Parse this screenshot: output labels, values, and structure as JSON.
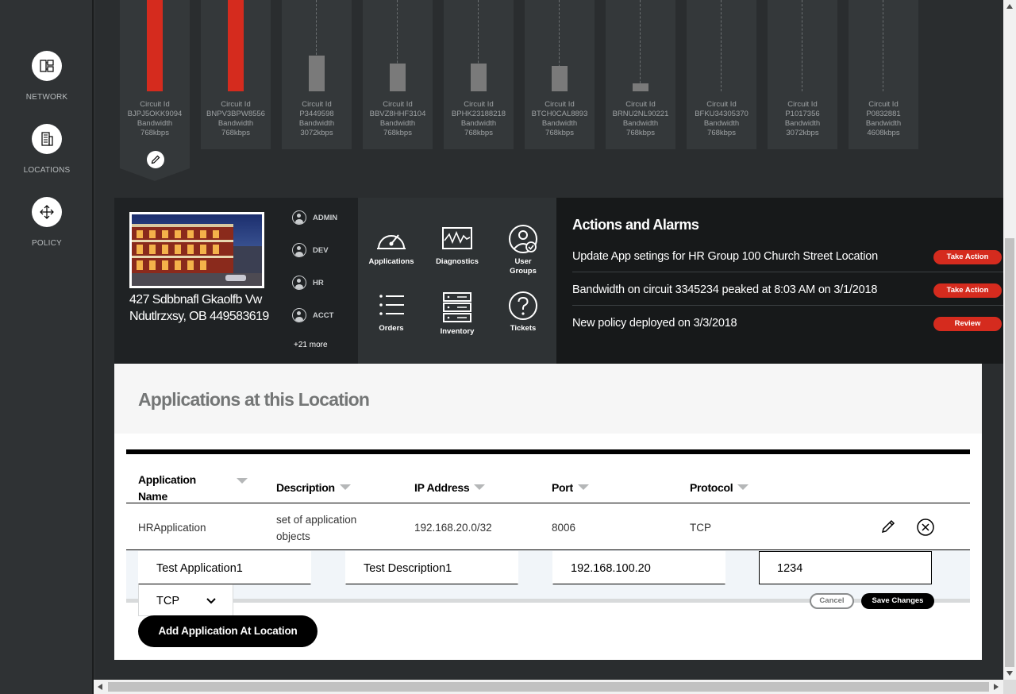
{
  "sidebar": {
    "items": [
      {
        "label": "NETWORK",
        "icon": "network-icon"
      },
      {
        "label": "LOCATIONS",
        "icon": "building-icon"
      },
      {
        "label": "POLICY",
        "icon": "move-arrows-icon"
      }
    ]
  },
  "circuits": [
    {
      "label": "Circuit Id",
      "id": "BJPJ5OKK9094",
      "bw_label": "Bandwidth",
      "bandwidth": "768kbps",
      "level": 1.0,
      "alert": true,
      "selected": true
    },
    {
      "label": "Circuit Id",
      "id": "BNPV3BPW8556",
      "bw_label": "Bandwidth",
      "bandwidth": "768kbps",
      "level": 1.0,
      "alert": true,
      "selected": false
    },
    {
      "label": "Circuit Id",
      "id": "P3449598",
      "bw_label": "Bandwidth",
      "bandwidth": "3072kbps",
      "level": 0.39,
      "alert": false,
      "selected": false
    },
    {
      "label": "Circuit Id",
      "id": "BBVZ8HHF3104",
      "bw_label": "Bandwidth",
      "bandwidth": "768kbps",
      "level": 0.3,
      "alert": false,
      "selected": false
    },
    {
      "label": "Circuit Id",
      "id": "BPHK23188218",
      "bw_label": "Bandwidth",
      "bandwidth": "768kbps",
      "level": 0.3,
      "alert": false,
      "selected": false
    },
    {
      "label": "Circuit Id",
      "id": "BTCH0CAL8893",
      "bw_label": "Bandwidth",
      "bandwidth": "768kbps",
      "level": 0.28,
      "alert": false,
      "selected": false
    },
    {
      "label": "Circuit Id",
      "id": "BRNU2NL90221",
      "bw_label": "Bandwidth",
      "bandwidth": "768kbps",
      "level": 0.09,
      "alert": false,
      "selected": false
    },
    {
      "label": "Circuit Id",
      "id": "BFKU34305370",
      "bw_label": "Bandwidth",
      "bandwidth": "768kbps",
      "level": 0.0,
      "alert": false,
      "selected": false
    },
    {
      "label": "Circuit Id",
      "id": "P1017356",
      "bw_label": "Bandwidth",
      "bandwidth": "3072kbps",
      "level": 0.0,
      "alert": false,
      "selected": false
    },
    {
      "label": "Circuit Id",
      "id": "P0832881",
      "bw_label": "Bandwidth",
      "bandwidth": "4608kbps",
      "level": 0.0,
      "alert": false,
      "selected": false
    }
  ],
  "location": {
    "address_line1": "427 Sdbbnafl Gkaolfb Vw",
    "address_line2": "Ndutlrzxsy, OB 449583619",
    "groups": [
      "ADMIN",
      "DEV",
      "HR",
      "ACCT"
    ],
    "more_groups": "+21 more"
  },
  "tiles": [
    {
      "label": "Applications",
      "icon": "speedometer-icon"
    },
    {
      "label": "Diagnostics",
      "icon": "waveform-icon"
    },
    {
      "label": "User Groups",
      "icon": "user-check-icon"
    },
    {
      "label": "Orders",
      "icon": "list-icon"
    },
    {
      "label": "Inventory",
      "icon": "server-icon"
    },
    {
      "label": "Tickets",
      "icon": "help-icon"
    }
  ],
  "alarms": {
    "title": "Actions and Alarms",
    "items": [
      {
        "text": "Update App setings for HR Group 100 Church Street Location",
        "action": "Take Action"
      },
      {
        "text": "Bandwidth on circuit 3345234 peaked at 8:03 AM on 3/1/2018",
        "action": "Take Action"
      },
      {
        "text": "New policy deployed on 3/3/2018",
        "action": "Review"
      }
    ]
  },
  "applications": {
    "title": "Applications at this Location",
    "columns": [
      "Application Name",
      "Description",
      "IP Address",
      "Port",
      "Protocol"
    ],
    "rows": [
      {
        "name": "HRApplication",
        "description": "set of application objects",
        "ip": "192.168.20.0/32",
        "port": "8006",
        "protocol": "TCP"
      }
    ],
    "edit_row": {
      "name": "Test Application1",
      "description": "Test Description1",
      "ip": "192.168.100.20",
      "port": "1234",
      "protocol": "TCP"
    },
    "cancel_label": "Cancel",
    "save_label": "Save Changes",
    "add_label": "Add Application At Location"
  },
  "colors": {
    "accent_red": "#d52b1e",
    "dark_bg": "#2a2d2f",
    "panel_black": "#17191a"
  }
}
